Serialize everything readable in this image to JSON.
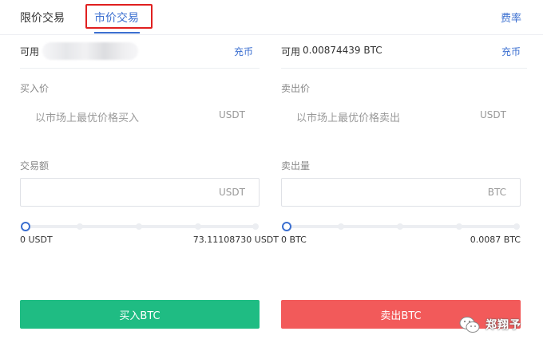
{
  "tabs": {
    "limit_label": "限价交易",
    "market_label": "市价交易",
    "fee_label": "费率"
  },
  "buy": {
    "available_label": "可用",
    "available_value": "",
    "deposit_label": "充币",
    "price_label": "买入价",
    "market_note": "以市场上最优价格买入",
    "price_unit": "USDT",
    "amount_label": "交易额",
    "amount_value": "",
    "amount_unit": "USDT",
    "slider_percent": 0,
    "slider_min": "0 USDT",
    "slider_max": "73.11108730 USDT",
    "button_label": "买入BTC"
  },
  "sell": {
    "available_label": "可用",
    "available_value": "0.00874439 BTC",
    "deposit_label": "充币",
    "price_label": "卖出价",
    "market_note": "以市场上最优价格卖出",
    "price_unit": "USDT",
    "amount_label": "卖出量",
    "amount_value": "",
    "amount_unit": "BTC",
    "slider_percent": 0,
    "slider_min": "0 BTC",
    "slider_max": "0.0087 BTC",
    "button_label": "卖出BTC"
  },
  "colors": {
    "accent": "#3b6fd0",
    "buy": "#1fbc83",
    "sell": "#f25a5a",
    "highlight_box": "#e02020"
  },
  "watermark": {
    "text": "郑翔予",
    "icon": "wechat-logo-icon"
  }
}
